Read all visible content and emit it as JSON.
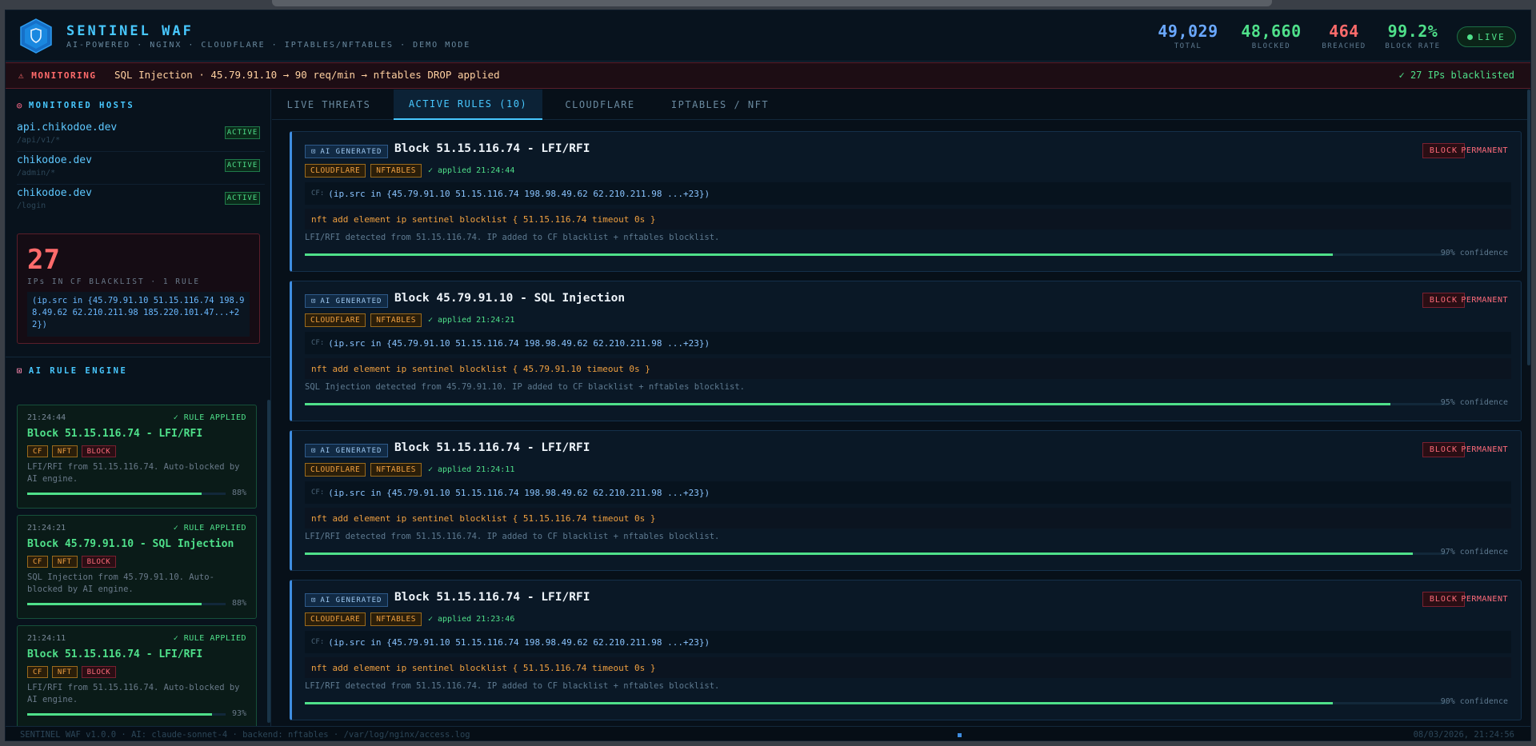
{
  "brand": {
    "title": "SENTINEL WAF",
    "subtitle": "AI-POWERED · NGINX · CLOUDFLARE · IPTABLES/NFTABLES · DEMO MODE"
  },
  "stats": [
    {
      "value": "49,029",
      "label": "TOTAL",
      "color": "#6aa8ff"
    },
    {
      "value": "48,660",
      "label": "BLOCKED",
      "color": "#4fe08a"
    },
    {
      "value": "464",
      "label": "BREACHED",
      "color": "#ff6b6b"
    },
    {
      "value": "99.2%",
      "label": "BLOCK RATE",
      "color": "#4fe08a"
    }
  ],
  "live_label": "LIVE",
  "monitor": {
    "label": "⚠ MONITORING",
    "text": "SQL Injection · 45.79.91.10 → 90 req/min → nftables DROP applied",
    "right": "✓ 27 IPs blacklisted"
  },
  "left": {
    "hosts_title": "MONITORED HOSTS",
    "hosts": [
      {
        "name": "api.chikodoe.dev",
        "path": "/api/v1/*",
        "status": "ACTIVE"
      },
      {
        "name": "chikodoe.dev",
        "path": "/admin/*",
        "status": "ACTIVE"
      },
      {
        "name": "chikodoe.dev",
        "path": "/login",
        "status": "ACTIVE"
      }
    ],
    "blacklist": {
      "count": "27",
      "label": "IPs IN CF BLACKLIST · 1 RULE",
      "expr": "(ip.src in {45.79.91.10 51.15.116.74 198.98.49.62 62.210.211.98 185.220.101.47...+22})"
    },
    "engine_title": "AI RULE ENGINE",
    "rules": [
      {
        "time": "21:24:44",
        "status": "✓ RULE APPLIED",
        "title": "Block 51.15.116.74 - LFI/RFI",
        "tags": [
          "CF",
          "NFT",
          "BLOCK"
        ],
        "desc": "LFI/RFI from 51.15.116.74. Auto-blocked by AI engine.",
        "confidence": 88,
        "pct": "88%"
      },
      {
        "time": "21:24:21",
        "status": "✓ RULE APPLIED",
        "title": "Block 45.79.91.10 - SQL Injection",
        "tags": [
          "CF",
          "NFT",
          "BLOCK"
        ],
        "desc": "SQL Injection from 45.79.91.10. Auto-blocked by AI engine.",
        "confidence": 88,
        "pct": "88%"
      },
      {
        "time": "21:24:11",
        "status": "✓ RULE APPLIED",
        "title": "Block 51.15.116.74 - LFI/RFI",
        "tags": [
          "CF",
          "NFT",
          "BLOCK"
        ],
        "desc": "LFI/RFI from 51.15.116.74. Auto-blocked by AI engine.",
        "confidence": 93,
        "pct": "93%"
      }
    ]
  },
  "tabs": [
    {
      "label": "LIVE THREATS",
      "active": false
    },
    {
      "label": "ACTIVE RULES (10)",
      "active": true
    },
    {
      "label": "CLOUDFLARE",
      "active": false
    },
    {
      "label": "IPTABLES / NFT",
      "active": false
    }
  ],
  "active_rules": [
    {
      "badge": "AI GENERATED",
      "title": "Block 51.15.116.74 - LFI/RFI",
      "tags": [
        "CLOUDFLARE",
        "NFTABLES"
      ],
      "applied": "✓ applied 21:24:44",
      "action": "BLOCK",
      "duration": "PERMANENT",
      "cf_prefix": "CF:",
      "cf": "(ip.src in {45.79.91.10 51.15.116.74 198.98.49.62 62.210.211.98 ...+23})",
      "nft": "nft add element ip sentinel blocklist { 51.15.116.74 timeout 0s }",
      "desc": "LFI/RFI detected from 51.15.116.74. IP added to CF blacklist + nftables blocklist.",
      "confidence": 90,
      "pct": "90% confidence"
    },
    {
      "badge": "AI GENERATED",
      "title": "Block 45.79.91.10 - SQL Injection",
      "tags": [
        "CLOUDFLARE",
        "NFTABLES"
      ],
      "applied": "✓ applied 21:24:21",
      "action": "BLOCK",
      "duration": "PERMANENT",
      "cf_prefix": "CF:",
      "cf": "(ip.src in {45.79.91.10 51.15.116.74 198.98.49.62 62.210.211.98 ...+23})",
      "nft": "nft add element ip sentinel blocklist { 45.79.91.10 timeout 0s }",
      "desc": "SQL Injection detected from 45.79.91.10. IP added to CF blacklist + nftables blocklist.",
      "confidence": 95,
      "pct": "95% confidence"
    },
    {
      "badge": "AI GENERATED",
      "title": "Block 51.15.116.74 - LFI/RFI",
      "tags": [
        "CLOUDFLARE",
        "NFTABLES"
      ],
      "applied": "✓ applied 21:24:11",
      "action": "BLOCK",
      "duration": "PERMANENT",
      "cf_prefix": "CF:",
      "cf": "(ip.src in {45.79.91.10 51.15.116.74 198.98.49.62 62.210.211.98 ...+23})",
      "nft": "nft add element ip sentinel blocklist { 51.15.116.74 timeout 0s }",
      "desc": "LFI/RFI detected from 51.15.116.74. IP added to CF blacklist + nftables blocklist.",
      "confidence": 97,
      "pct": "97% confidence"
    },
    {
      "badge": "AI GENERATED",
      "title": "Block 51.15.116.74 - LFI/RFI",
      "tags": [
        "CLOUDFLARE",
        "NFTABLES"
      ],
      "applied": "✓ applied 21:23:46",
      "action": "BLOCK",
      "duration": "PERMANENT",
      "cf_prefix": "CF:",
      "cf": "(ip.src in {45.79.91.10 51.15.116.74 198.98.49.62 62.210.211.98 ...+23})",
      "nft": "nft add element ip sentinel blocklist { 51.15.116.74 timeout 0s }",
      "desc": "LFI/RFI detected from 51.15.116.74. IP added to CF blacklist + nftables blocklist.",
      "confidence": 90,
      "pct": "90% confidence"
    }
  ],
  "footer": {
    "left": "SENTINEL WAF v1.0.0 · AI: claude-sonnet-4 · backend: nftables · /var/log/nginx/access.log",
    "right": "08/03/2026, 21:24:56"
  }
}
